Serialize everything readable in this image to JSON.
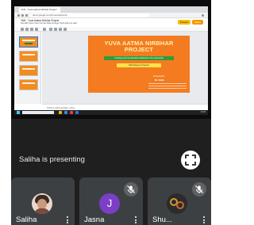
{
  "shared_screen": {
    "browser_tab": "YAN - Yuva Aatma Nirbhar Project",
    "url": "docs.google.com/presentation/d/...",
    "doc_title": "YAN - Yuva Aatma Nirbhar Project",
    "menus": "File  Edit  View  Insert  Format  Slide  Arrange  Tools  Add-ons  Help",
    "present_label": "Present",
    "share_label": "Share",
    "notes_placeholder": "Click to add speaker notes",
    "clock": "12:04",
    "slide": {
      "title_line1": "YUVA AATMA NIRBHAR",
      "title_line2": "PROJECT",
      "subtitle": "Creating youth sustainable livelihoods in the community",
      "tag": "Skill Mapping Program",
      "presented_by": "Presented By",
      "presenter": "Ms. Saliha"
    }
  },
  "presenting_text": "Saliha is presenting",
  "participants": [
    {
      "name": "Saliha",
      "avatar": "photo",
      "muted": false
    },
    {
      "name": "Jasna",
      "avatar": "J",
      "avatar_color": "#7b3fc6",
      "muted": true
    },
    {
      "name": "Shu...",
      "avatar": "image",
      "muted": true
    }
  ]
}
